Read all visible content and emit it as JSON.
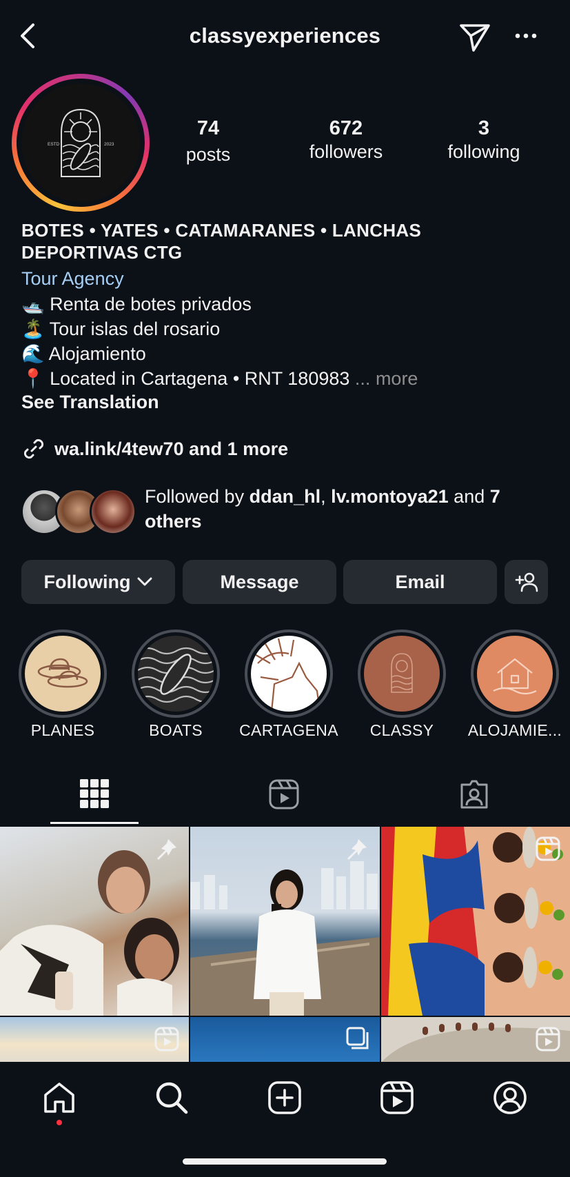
{
  "header": {
    "username": "classyexperiences",
    "back_icon": "chevron-left-icon",
    "send_icon": "paper-plane-icon",
    "more_icon": "ellipsis-icon"
  },
  "profile": {
    "avatar_text_left": "ESTD",
    "avatar_text_right": "2023",
    "stats": [
      {
        "value": "74",
        "label": "posts"
      },
      {
        "value": "672",
        "label": "followers"
      },
      {
        "value": "3",
        "label": "following"
      }
    ],
    "bio_title_line1": "BOTES • YATES • CATAMARANES • LANCHAS",
    "bio_title_line2": "DEPORTIVAS CTG",
    "category": "Tour Agency",
    "bio_lines": [
      {
        "emoji": "🛥️",
        "text": "Renta de botes privados"
      },
      {
        "emoji": "🏝️",
        "text": "Tour islas del rosario"
      },
      {
        "emoji": "🌊",
        "text": "Alojamiento"
      },
      {
        "emoji": "📍",
        "text": "Located in Cartagena • RNT 180983"
      }
    ],
    "ellipsis": "...",
    "more_label": "more",
    "see_translation": "See Translation",
    "link_text": "wa.link/4tew70 and 1 more",
    "followed_by_prefix": "Followed by ",
    "followed_user1": "ddan_hl",
    "followed_sep": ", ",
    "followed_user2": "lv.montoya21",
    "followed_and": " and ",
    "followed_others": "7 others"
  },
  "actions": {
    "following_label": "Following",
    "message_label": "Message",
    "email_label": "Email",
    "add_person_icon": "add-person-icon"
  },
  "highlights": [
    {
      "label": "PLANES",
      "bg": "#e8cfa8"
    },
    {
      "label": "BOATS",
      "bg": "#2a2a2a"
    },
    {
      "label": "CARTAGENA",
      "bg": "#ffffff"
    },
    {
      "label": "CLASSY",
      "bg": "#a8624a"
    },
    {
      "label": "ALOJAMIE...",
      "bg": "#e08a64"
    }
  ],
  "tabs": [
    {
      "name": "grid-icon",
      "active": true
    },
    {
      "name": "reels-icon",
      "active": false
    },
    {
      "name": "tagged-icon",
      "active": false
    }
  ],
  "colors": {
    "background": "#0c1017",
    "button_bg": "#262a31",
    "link_blue": "#a6cff5",
    "notification_dot": "#ff3040"
  },
  "bottom_nav": [
    "home-icon",
    "search-icon",
    "create-icon",
    "reels-icon",
    "profile-icon"
  ]
}
